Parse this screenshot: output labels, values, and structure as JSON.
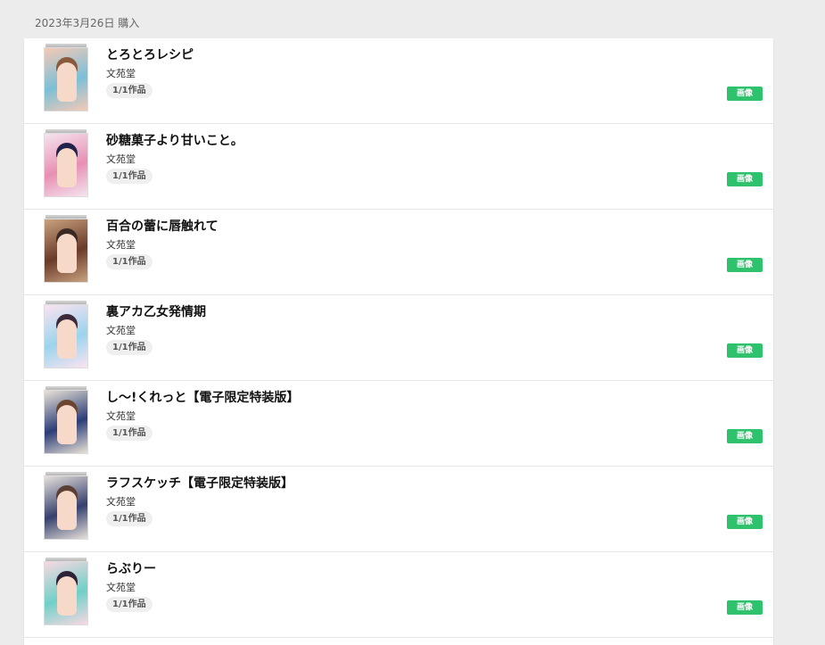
{
  "purchase_date_label": "2023年3月26日 購入",
  "items": [
    {
      "title": "とろとろレシピ",
      "publisher": "文苑堂",
      "volume": "1/1作品",
      "format": "画像",
      "cover_colors": [
        "#f5c9b5",
        "#7bc0d8",
        "#8a5a3c"
      ]
    },
    {
      "title": "砂糖菓子より甘いこと。",
      "publisher": "文苑堂",
      "volume": "1/1作品",
      "format": "画像",
      "cover_colors": [
        "#f4e4ee",
        "#e88fb4",
        "#23224a"
      ]
    },
    {
      "title": "百合の蕾に唇触れて",
      "publisher": "文苑堂",
      "volume": "1/1作品",
      "format": "画像",
      "cover_colors": [
        "#c9a27e",
        "#6a3a2a",
        "#3b2a24"
      ]
    },
    {
      "title": "裏アカ乙女発情期",
      "publisher": "文苑堂",
      "volume": "1/1作品",
      "format": "画像",
      "cover_colors": [
        "#fbe3f0",
        "#9bd4ee",
        "#3a2b3a"
      ]
    },
    {
      "title": "し〜!くれっと【電子限定特装版】",
      "publisher": "文苑堂",
      "volume": "1/1作品",
      "format": "画像",
      "cover_colors": [
        "#e9e2d7",
        "#2b3d78",
        "#6b4530"
      ]
    },
    {
      "title": "ラフスケッチ【電子限定特装版】",
      "publisher": "文苑堂",
      "volume": "1/1作品",
      "format": "画像",
      "cover_colors": [
        "#e7e1dc",
        "#35406e",
        "#5b3f33"
      ]
    },
    {
      "title": "らぶりー",
      "publisher": "文苑堂",
      "volume": "1/1作品",
      "format": "画像",
      "cover_colors": [
        "#f8d8e2",
        "#6fd0c8",
        "#2d2238"
      ]
    }
  ]
}
